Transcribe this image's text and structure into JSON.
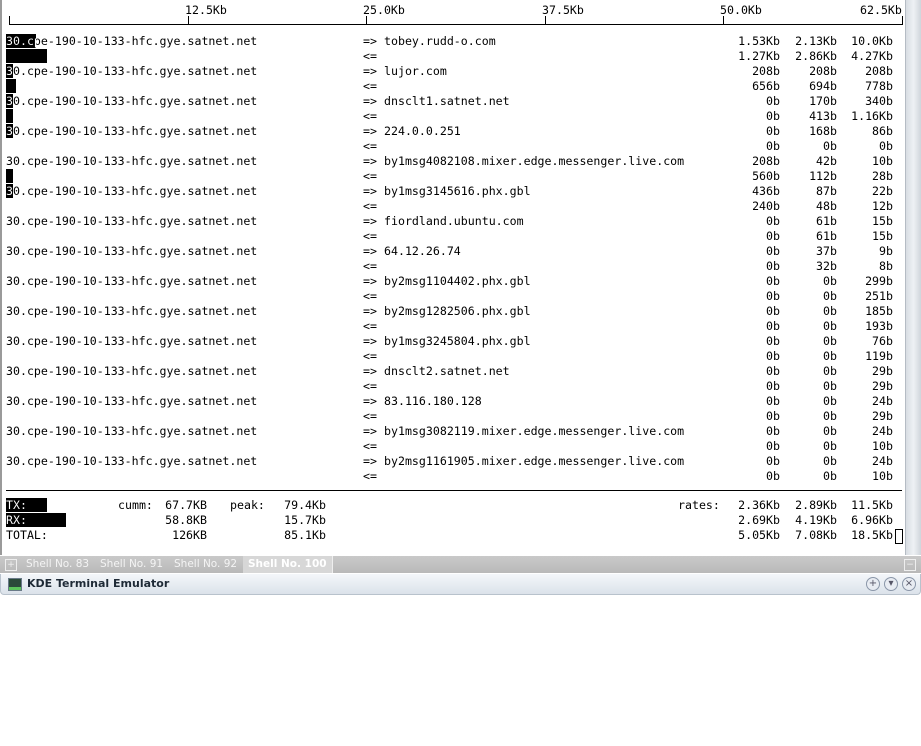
{
  "scale": {
    "ticks": [
      "12.5Kb",
      "25.0Kb",
      "37.5Kb",
      "50.0Kb",
      "62.5Kb"
    ],
    "max_kb": 62.5
  },
  "flows": [
    {
      "src": "30.cpe-190-10-133-hfc.gye.satnet.net",
      "dst": "tobey.rudd-o.com",
      "out": [
        "1.53Kb",
        "2.13Kb",
        "10.0Kb"
      ],
      "in": [
        "1.27Kb",
        "2.86Kb",
        "4.27Kb"
      ]
    },
    {
      "src": "30.cpe-190-10-133-hfc.gye.satnet.net",
      "dst": "lujor.com",
      "out": [
        "208b",
        "208b",
        "208b"
      ],
      "in": [
        "656b",
        "694b",
        "778b"
      ]
    },
    {
      "src": "30.cpe-190-10-133-hfc.gye.satnet.net",
      "dst": "dnsclt1.satnet.net",
      "out": [
        "0b",
        "170b",
        "340b"
      ],
      "in": [
        "0b",
        "413b",
        "1.16Kb"
      ]
    },
    {
      "src": "30.cpe-190-10-133-hfc.gye.satnet.net",
      "dst": "224.0.0.251",
      "out": [
        "0b",
        "168b",
        "86b"
      ],
      "in": [
        "0b",
        "0b",
        "0b"
      ]
    },
    {
      "src": "30.cpe-190-10-133-hfc.gye.satnet.net",
      "dst": "by1msg4082108.mixer.edge.messenger.live.com",
      "out": [
        "208b",
        "42b",
        "10b"
      ],
      "in": [
        "560b",
        "112b",
        "28b"
      ]
    },
    {
      "src": "30.cpe-190-10-133-hfc.gye.satnet.net",
      "dst": "by1msg3145616.phx.gbl",
      "out": [
        "436b",
        "87b",
        "22b"
      ],
      "in": [
        "240b",
        "48b",
        "12b"
      ]
    },
    {
      "src": "30.cpe-190-10-133-hfc.gye.satnet.net",
      "dst": "fiordland.ubuntu.com",
      "out": [
        "0b",
        "61b",
        "15b"
      ],
      "in": [
        "0b",
        "61b",
        "15b"
      ]
    },
    {
      "src": "30.cpe-190-10-133-hfc.gye.satnet.net",
      "dst": "64.12.26.74",
      "out": [
        "0b",
        "37b",
        "9b"
      ],
      "in": [
        "0b",
        "32b",
        "8b"
      ]
    },
    {
      "src": "30.cpe-190-10-133-hfc.gye.satnet.net",
      "dst": "by2msg1104402.phx.gbl",
      "out": [
        "0b",
        "0b",
        "299b"
      ],
      "in": [
        "0b",
        "0b",
        "251b"
      ]
    },
    {
      "src": "30.cpe-190-10-133-hfc.gye.satnet.net",
      "dst": "by2msg1282506.phx.gbl",
      "out": [
        "0b",
        "0b",
        "185b"
      ],
      "in": [
        "0b",
        "0b",
        "193b"
      ]
    },
    {
      "src": "30.cpe-190-10-133-hfc.gye.satnet.net",
      "dst": "by1msg3245804.phx.gbl",
      "out": [
        "0b",
        "0b",
        "76b"
      ],
      "in": [
        "0b",
        "0b",
        "119b"
      ]
    },
    {
      "src": "30.cpe-190-10-133-hfc.gye.satnet.net",
      "dst": "dnsclt2.satnet.net",
      "out": [
        "0b",
        "0b",
        "29b"
      ],
      "in": [
        "0b",
        "0b",
        "29b"
      ]
    },
    {
      "src": "30.cpe-190-10-133-hfc.gye.satnet.net",
      "dst": "83.116.180.128",
      "out": [
        "0b",
        "0b",
        "24b"
      ],
      "in": [
        "0b",
        "0b",
        "29b"
      ]
    },
    {
      "src": "30.cpe-190-10-133-hfc.gye.satnet.net",
      "dst": "by1msg3082119.mixer.edge.messenger.live.com",
      "out": [
        "0b",
        "0b",
        "24b"
      ],
      "in": [
        "0b",
        "0b",
        "10b"
      ]
    },
    {
      "src": "30.cpe-190-10-133-hfc.gye.satnet.net",
      "dst": "by2msg1161905.mixer.edge.messenger.live.com",
      "out": [
        "0b",
        "0b",
        "24b"
      ],
      "in": [
        "0b",
        "0b",
        "10b"
      ]
    }
  ],
  "arrows": {
    "out": "=>",
    "in": "<="
  },
  "totals": {
    "cumm_label": "cumm:",
    "peak_label": "peak:",
    "rates_label": "rates:",
    "rows": [
      {
        "label": "TX:",
        "cumm": "67.7KB",
        "peak": "79.4Kb",
        "rates": [
          "2.36Kb",
          "2.89Kb",
          "11.5Kb"
        ]
      },
      {
        "label": "RX:",
        "cumm": "58.8KB",
        "peak": "15.7Kb",
        "rates": [
          "2.69Kb",
          "4.19Kb",
          "6.96Kb"
        ]
      },
      {
        "label": "TOTAL:",
        "cumm": "126KB",
        "peak": "85.1Kb",
        "rates": [
          "5.05Kb",
          "7.08Kb",
          "18.5Kb"
        ]
      }
    ]
  },
  "tabs": [
    {
      "label": "Shell No. 83",
      "active": false
    },
    {
      "label": "Shell No. 91",
      "active": false
    },
    {
      "label": "Shell No. 92",
      "active": false
    },
    {
      "label": "Shell No. 100",
      "active": true
    }
  ],
  "window": {
    "title": "KDE Terminal Emulator"
  }
}
